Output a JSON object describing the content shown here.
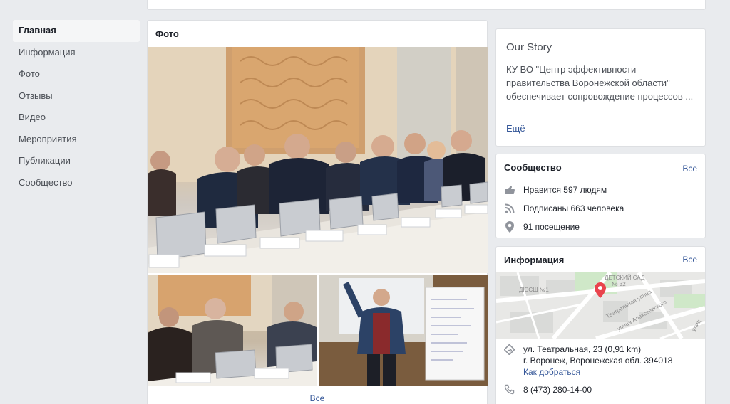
{
  "sidebar": {
    "items": [
      {
        "label": "Главная"
      },
      {
        "label": "Информация"
      },
      {
        "label": "Фото"
      },
      {
        "label": "Отзывы"
      },
      {
        "label": "Видео"
      },
      {
        "label": "Мероприятия"
      },
      {
        "label": "Публикации"
      },
      {
        "label": "Сообщество"
      }
    ]
  },
  "photos": {
    "title": "Фото",
    "see_all": "Все"
  },
  "story": {
    "title": "Our Story",
    "text": "КУ ВО \"Центр эффективности правительства Воронежской области\" обеспечивает сопровождение процессов ...",
    "more": "Ещё"
  },
  "community": {
    "title": "Сообщество",
    "see_all": "Все",
    "likes": "Нравится 597 людям",
    "follows": "Подписаны 663 человека",
    "checkins": "91 посещение"
  },
  "info": {
    "title": "Информация",
    "see_all": "Все",
    "map": {
      "label_kindergarten": "ДЕТСКИЙ САД",
      "label_kindergarten_num": "№ 32",
      "label_school": "ДЮСШ №1",
      "label_street1": "Театральная улица",
      "label_street2": "улица Алексеевского",
      "label_street3": "улиц"
    },
    "address_line1": "ул. Театральная, 23 (0,91 km)",
    "address_line2": "г. Воронеж, Воронежская обл. 394018",
    "directions": "Как добраться",
    "phone": "8 (473) 280-14-00"
  },
  "colors": {
    "background": "#e9ebee",
    "link": "#365899",
    "map_pin": "#e9444d"
  }
}
